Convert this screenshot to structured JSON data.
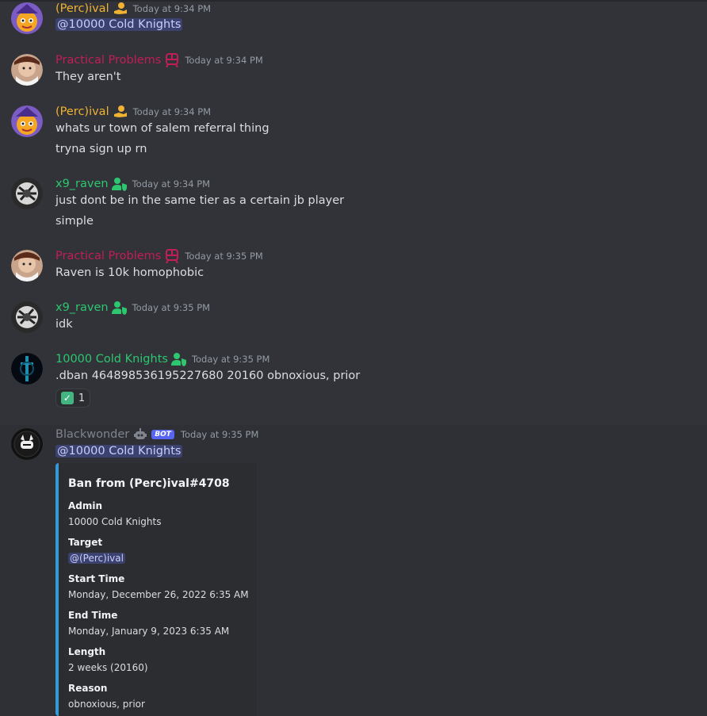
{
  "colors": {
    "percival": "#f0b232",
    "practical": "#c21e56",
    "raven": "#2dc770",
    "knights": "#2dc770",
    "blackwonder": "#80848e",
    "embed_accent": "#3498db",
    "mention_bg": "#3c4270"
  },
  "messages": [
    {
      "author": "(Perc)ival",
      "icon": "hand-coin-icon",
      "time": "Today at 9:34 PM",
      "lines": [
        "@10000 Cold Knights"
      ]
    },
    {
      "author": "Practical Problems",
      "icon": "train-icon",
      "time": "Today at 9:34 PM",
      "lines": [
        "They aren't"
      ]
    },
    {
      "author": "(Perc)ival",
      "icon": "hand-coin-icon",
      "time": "Today at 9:34 PM",
      "lines": [
        "whats ur town of salem referral thing",
        "tryna sign up rn"
      ]
    },
    {
      "author": "x9_raven",
      "icon": "moderator-icon",
      "time": "Today at 9:34 PM",
      "lines": [
        "just dont be in the same tier as a certain jb player",
        "simple"
      ]
    },
    {
      "author": "Practical Problems",
      "icon": "train-icon",
      "time": "Today at 9:35 PM",
      "lines": [
        "Raven is 10k homophobic"
      ]
    },
    {
      "author": "x9_raven",
      "icon": "moderator-icon",
      "time": "Today at 9:35 PM",
      "lines": [
        "idk"
      ]
    },
    {
      "author": "10000 Cold Knights",
      "icon": "moderator-icon",
      "time": "Today at 9:35 PM",
      "lines": [
        ".dban 464898536195227680 20160 obnoxious, prior"
      ],
      "reaction": {
        "emoji": "check-mark-icon",
        "count": "1"
      }
    },
    {
      "author": "Blackwonder",
      "badge": "BOT",
      "time": "Today at 9:35 PM",
      "lines": [
        "@10000 Cold Knights"
      ]
    }
  ],
  "embed": {
    "title": "Ban from (Perc)ival#4708",
    "fields": [
      {
        "name": "Admin",
        "value": "10000 Cold Knights"
      },
      {
        "name": "Target",
        "value": "@(Perc)ival"
      },
      {
        "name": "Start Time",
        "value": "Monday, December 26, 2022 6:35 AM"
      },
      {
        "name": "End Time",
        "value": "Monday, January 9, 2023 6:35 AM"
      },
      {
        "name": "Length",
        "value": "2 weeks (20160)"
      },
      {
        "name": "Reason",
        "value": "obnoxious, prior"
      }
    ]
  }
}
